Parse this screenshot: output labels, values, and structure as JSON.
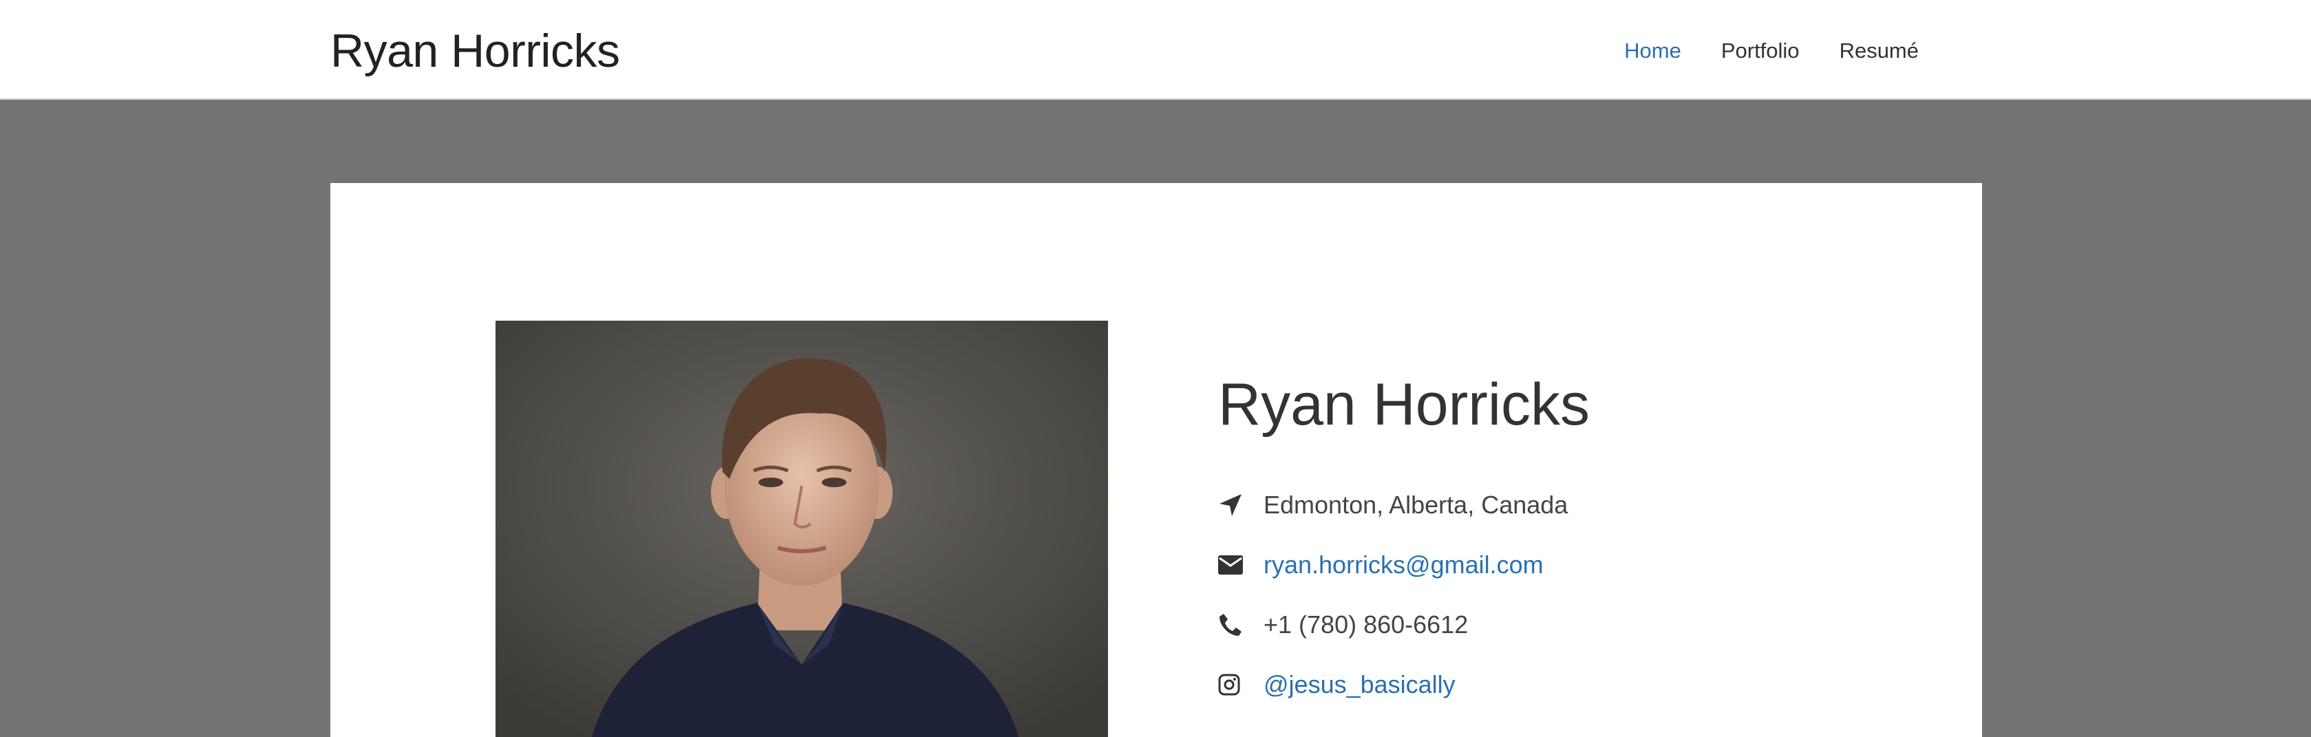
{
  "header": {
    "site_title": "Ryan Horricks",
    "nav": [
      {
        "label": "Home",
        "active": true
      },
      {
        "label": "Portfolio",
        "active": false
      },
      {
        "label": "Resumé",
        "active": false
      }
    ]
  },
  "profile": {
    "name": "Ryan Horricks",
    "location": "Edmonton, Alberta, Canada",
    "email": "ryan.horricks@gmail.com",
    "phone": "+1 (780) 860-6612",
    "instagram": "@jesus_basically",
    "icons": [
      "location-arrow-icon",
      "envelope-icon",
      "phone-icon",
      "instagram-icon"
    ]
  },
  "colors": {
    "page_background": "#737373",
    "link": "#2a6fb0",
    "text": "#333333"
  }
}
